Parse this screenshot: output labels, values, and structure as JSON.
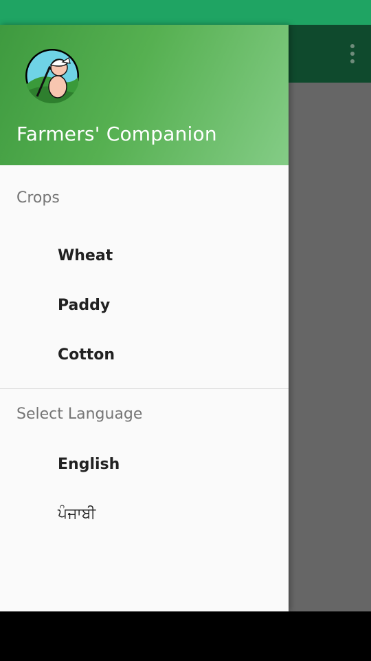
{
  "colors": {
    "status_bar": "#1fa463",
    "toolbar": "#0f4a2d",
    "scrim": "#666666",
    "drawer_bg": "#fafafa",
    "header_gradient_start": "#3e9a3f",
    "header_gradient_end": "#84cc86"
  },
  "toolbar": {
    "overflow_icon": "more-vert-icon"
  },
  "drawer": {
    "header": {
      "app_name": "Farmers' Companion",
      "logo_icon": "farmer-logo"
    },
    "sections": [
      {
        "title": "Crops",
        "items": [
          "Wheat",
          "Paddy",
          "Cotton"
        ]
      },
      {
        "title": "Select Language",
        "items": [
          "English",
          "ਪੰਜਾਬੀ"
        ]
      }
    ]
  }
}
